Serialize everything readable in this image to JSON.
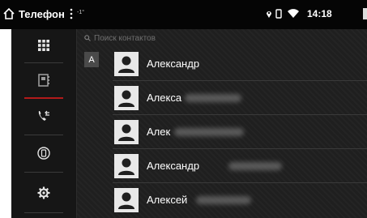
{
  "statusbar": {
    "app_title": "Телефон",
    "temperature": "-1°",
    "time": "14:18"
  },
  "sidebar": {
    "items": [
      {
        "icon": "dialpad-icon"
      },
      {
        "icon": "contacts-book-icon"
      },
      {
        "icon": "call-log-icon"
      },
      {
        "icon": "phone-device-icon"
      },
      {
        "icon": "gear-icon"
      }
    ]
  },
  "search": {
    "placeholder": "Поиск контактов"
  },
  "contacts": {
    "section_letter": "A",
    "items": [
      {
        "name": "Александр",
        "redacted": false
      },
      {
        "name": "Алекса",
        "redacted": true
      },
      {
        "name": "Алек",
        "redacted": true
      },
      {
        "name": "Александр",
        "redacted": true
      },
      {
        "name": "Алексей",
        "redacted": true
      }
    ]
  },
  "colors": {
    "statusbar_bg": "#050505",
    "app_bg": "#1f1f1f",
    "sidebar_bg": "#161616",
    "active_indicator": "#b21a1a",
    "avatar_bg": "#e8e8e8"
  }
}
